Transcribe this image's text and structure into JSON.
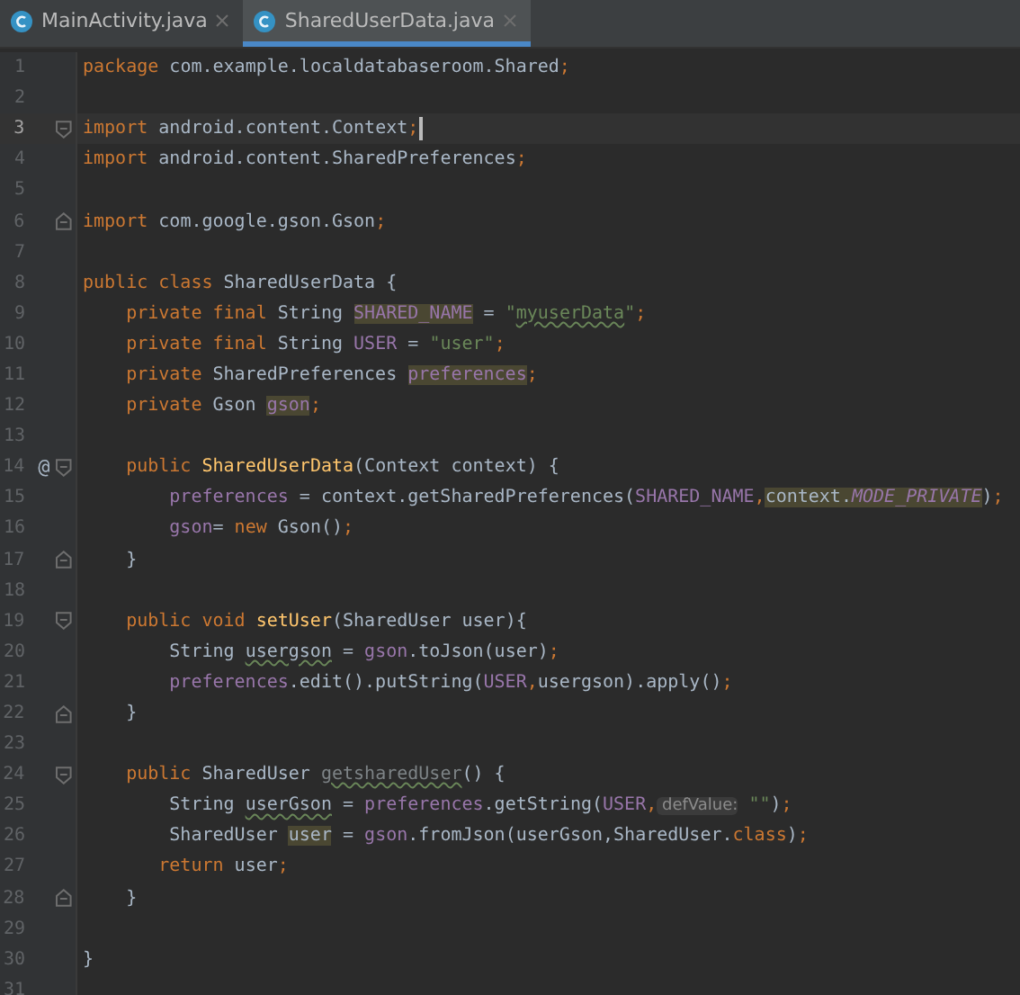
{
  "tabs": [
    {
      "label": "MainActivity.java",
      "selected": false
    },
    {
      "label": "SharedUserData.java",
      "selected": true
    }
  ],
  "lines": [
    {
      "number": "1",
      "current": false,
      "tokens": [
        {
          "text": "package ",
          "kind": "kw"
        },
        {
          "text": "com.example.localdatabaseroom.Shared",
          "kind": "txt"
        },
        {
          "text": ";",
          "kind": "kw"
        }
      ]
    },
    {
      "number": "2",
      "current": false
    },
    {
      "number": "3",
      "current": true,
      "fold": {
        "kind": "start"
      },
      "caret": true,
      "tokens": [
        {
          "text": "import ",
          "kind": "kw"
        },
        {
          "text": "android.content.Context",
          "kind": "txt"
        },
        {
          "text": ";",
          "kind": "kw"
        }
      ]
    },
    {
      "number": "4",
      "current": false,
      "tokens": [
        {
          "text": "import ",
          "kind": "kw"
        },
        {
          "text": "android.content.SharedPreferences",
          "kind": "txt"
        },
        {
          "text": ";",
          "kind": "kw"
        }
      ]
    },
    {
      "number": "5",
      "current": false
    },
    {
      "number": "6",
      "current": false,
      "fold": {
        "kind": "end"
      },
      "tokens": [
        {
          "text": "import ",
          "kind": "kw"
        },
        {
          "text": "com.google.gson.Gson",
          "kind": "txt"
        },
        {
          "text": ";",
          "kind": "kw"
        }
      ]
    },
    {
      "number": "7",
      "current": false
    },
    {
      "number": "8",
      "current": false,
      "tokens": [
        {
          "text": "public class ",
          "kind": "kw"
        },
        {
          "text": "SharedUserData {",
          "kind": "txt"
        }
      ]
    },
    {
      "number": "9",
      "current": false,
      "tokens": [
        {
          "text": "    private final ",
          "kind": "kw"
        },
        {
          "text": "String ",
          "kind": "txt"
        },
        {
          "text": "SHARED_NAME",
          "kind": "fld_hl"
        },
        {
          "text": " = ",
          "kind": "txt"
        },
        {
          "text": "\"",
          "kind": "str"
        },
        {
          "text": "myuserData",
          "kind": "str_warn"
        },
        {
          "text": "\"",
          "kind": "str"
        },
        {
          "text": ";",
          "kind": "kw"
        }
      ]
    },
    {
      "number": "10",
      "current": false,
      "tokens": [
        {
          "text": "    private final ",
          "kind": "kw"
        },
        {
          "text": "String ",
          "kind": "txt"
        },
        {
          "text": "USER",
          "kind": "fld"
        },
        {
          "text": " = ",
          "kind": "txt"
        },
        {
          "text": "\"user\"",
          "kind": "str"
        },
        {
          "text": ";",
          "kind": "kw"
        }
      ]
    },
    {
      "number": "11",
      "current": false,
      "tokens": [
        {
          "text": "    private ",
          "kind": "kw"
        },
        {
          "text": "SharedPreferences ",
          "kind": "txt"
        },
        {
          "text": "preferences",
          "kind": "fld_hl"
        },
        {
          "text": ";",
          "kind": "kw"
        }
      ]
    },
    {
      "number": "12",
      "current": false,
      "tokens": [
        {
          "text": "    private ",
          "kind": "kw"
        },
        {
          "text": "Gson ",
          "kind": "txt"
        },
        {
          "text": "gson",
          "kind": "fld_hl"
        },
        {
          "text": ";",
          "kind": "kw"
        }
      ]
    },
    {
      "number": "13",
      "current": false
    },
    {
      "number": "14",
      "current": false,
      "marker": "@",
      "fold": {
        "kind": "start"
      },
      "tokens": [
        {
          "text": "    public ",
          "kind": "kw"
        },
        {
          "text": "SharedUserData",
          "kind": "fn"
        },
        {
          "text": "(Context context) {",
          "kind": "txt"
        }
      ]
    },
    {
      "number": "15",
      "current": false,
      "tokens": [
        {
          "text": "        preferences",
          "kind": "fld"
        },
        {
          "text": " = context.getSharedPreferences(",
          "kind": "txt"
        },
        {
          "text": "SHARED_NAME",
          "kind": "fld"
        },
        {
          "text": ",",
          "kind": "kw"
        },
        {
          "text": "context.",
          "kind": "txt_hl"
        },
        {
          "text": "MODE_PRIVATE",
          "kind": "cst_hl"
        },
        {
          "text": ")",
          "kind": "txt"
        },
        {
          "text": ";",
          "kind": "kw"
        }
      ]
    },
    {
      "number": "16",
      "current": false,
      "tokens": [
        {
          "text": "        gson",
          "kind": "fld"
        },
        {
          "text": "= ",
          "kind": "txt"
        },
        {
          "text": "new ",
          "kind": "kw"
        },
        {
          "text": "Gson()",
          "kind": "txt"
        },
        {
          "text": ";",
          "kind": "kw"
        }
      ]
    },
    {
      "number": "17",
      "current": false,
      "fold": {
        "kind": "end"
      },
      "tokens": [
        {
          "text": "    }",
          "kind": "txt"
        }
      ]
    },
    {
      "number": "18",
      "current": false
    },
    {
      "number": "19",
      "current": false,
      "fold": {
        "kind": "start"
      },
      "tokens": [
        {
          "text": "    public void ",
          "kind": "kw"
        },
        {
          "text": "setUser",
          "kind": "fn"
        },
        {
          "text": "(SharedUser user){",
          "kind": "txt"
        }
      ]
    },
    {
      "number": "20",
      "current": false,
      "tokens": [
        {
          "text": "        String ",
          "kind": "txt"
        },
        {
          "text": "usergson",
          "kind": "txt_warn"
        },
        {
          "text": " = ",
          "kind": "txt"
        },
        {
          "text": "gson",
          "kind": "fld"
        },
        {
          "text": ".toJson(user)",
          "kind": "txt"
        },
        {
          "text": ";",
          "kind": "kw"
        }
      ]
    },
    {
      "number": "21",
      "current": false,
      "tokens": [
        {
          "text": "        preferences",
          "kind": "fld"
        },
        {
          "text": ".edit().putString(",
          "kind": "txt"
        },
        {
          "text": "USER",
          "kind": "fld"
        },
        {
          "text": ",",
          "kind": "kw"
        },
        {
          "text": "usergson).apply()",
          "kind": "txt"
        },
        {
          "text": ";",
          "kind": "kw"
        }
      ]
    },
    {
      "number": "22",
      "current": false,
      "fold": {
        "kind": "end"
      },
      "tokens": [
        {
          "text": "    }",
          "kind": "txt"
        }
      ]
    },
    {
      "number": "23",
      "current": false
    },
    {
      "number": "24",
      "current": false,
      "fold": {
        "kind": "start"
      },
      "tokens": [
        {
          "text": "    public ",
          "kind": "kw"
        },
        {
          "text": "SharedUser ",
          "kind": "txt"
        },
        {
          "text": "getsharedUser",
          "kind": "unused_warn"
        },
        {
          "text": "() {",
          "kind": "txt"
        }
      ]
    },
    {
      "number": "25",
      "current": false,
      "tokens": [
        {
          "text": "        String ",
          "kind": "txt"
        },
        {
          "text": "userGson",
          "kind": "txt_warn"
        },
        {
          "text": " = ",
          "kind": "txt"
        },
        {
          "text": "preferences",
          "kind": "fld"
        },
        {
          "text": ".getString(",
          "kind": "txt"
        },
        {
          "text": "USER",
          "kind": "fld"
        },
        {
          "text": ",",
          "kind": "kw"
        },
        {
          "text": " defValue:",
          "kind": "hint"
        },
        {
          "text": " \"\"",
          "kind": "str"
        },
        {
          "text": ")",
          "kind": "txt"
        },
        {
          "text": ";",
          "kind": "kw"
        }
      ]
    },
    {
      "number": "26",
      "current": false,
      "tokens": [
        {
          "text": "        SharedUser ",
          "kind": "txt"
        },
        {
          "text": "user",
          "kind": "txt_hl"
        },
        {
          "text": " = ",
          "kind": "txt"
        },
        {
          "text": "gson",
          "kind": "fld"
        },
        {
          "text": ".fromJson(userGson,SharedUser.",
          "kind": "txt"
        },
        {
          "text": "class",
          "kind": "kw"
        },
        {
          "text": ")",
          "kind": "txt"
        },
        {
          "text": ";",
          "kind": "kw"
        }
      ]
    },
    {
      "number": "27",
      "current": false,
      "tokens": [
        {
          "text": "       return ",
          "kind": "kw"
        },
        {
          "text": "user",
          "kind": "txt"
        },
        {
          "text": ";",
          "kind": "kw"
        }
      ]
    },
    {
      "number": "28",
      "current": false,
      "fold": {
        "kind": "end"
      },
      "tokens": [
        {
          "text": "    }",
          "kind": "txt"
        }
      ]
    },
    {
      "number": "29",
      "current": false
    },
    {
      "number": "30",
      "current": false,
      "tokens": [
        {
          "text": "}",
          "kind": "txt"
        }
      ]
    },
    {
      "number": "31",
      "current": false
    }
  ]
}
